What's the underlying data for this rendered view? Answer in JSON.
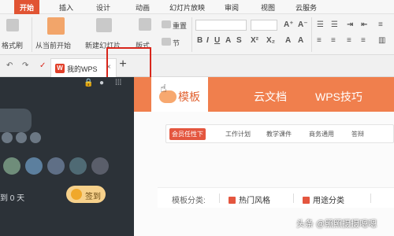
{
  "menubar": {
    "items": [
      "开始",
      "插入",
      "设计",
      "动画",
      "幻灯片放映",
      "审阅",
      "视图",
      "云服务"
    ]
  },
  "ribbon": {
    "format_painter": "格式刷",
    "from_start": "从当前开始",
    "new_slide": "新建幻灯片",
    "layout": "版式",
    "reset": "重置",
    "section": "节"
  },
  "tabbar": {
    "tab_title": "我的WPS",
    "close_glyph": "×",
    "new_tab_glyph": "+"
  },
  "left_panel": {
    "stat_text": "到 0 天",
    "signin_label": "签到"
  },
  "nav": {
    "items": [
      "模板",
      "云文档",
      "WPS技巧"
    ]
  },
  "chips": [
    "会员任性下",
    "工作计划",
    "教学课件",
    "商务通用",
    "答辩"
  ],
  "categories": {
    "label": "模板分类:",
    "options": [
      "热门风格",
      "用途分类"
    ]
  },
  "watermark": "头条 @照照摄摄嗯嗯",
  "colors": {
    "accent": "#e15433",
    "nav_orange": "#f07f4d",
    "panel_dark": "#2c3238",
    "highlight_red": "#d8261b"
  }
}
